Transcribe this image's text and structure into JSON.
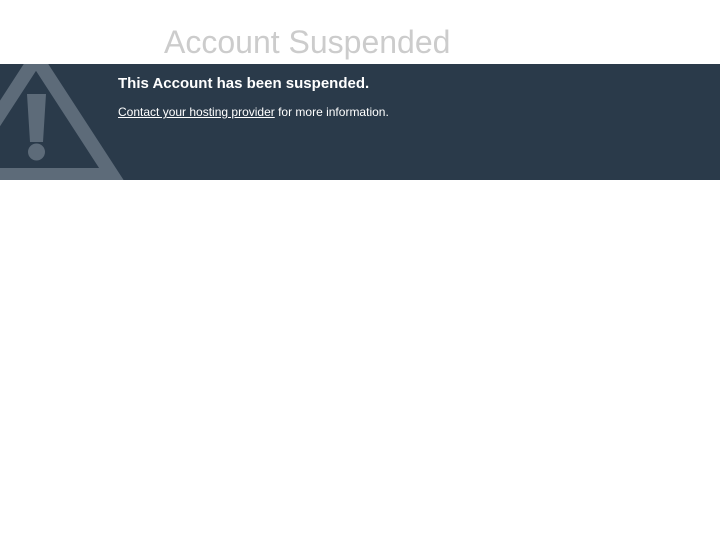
{
  "page": {
    "title": "Account Suspended"
  },
  "banner": {
    "heading": "This Account has been suspended.",
    "link_text": "Contact your hosting provider",
    "suffix_text": " for more information.",
    "icon": "warning-icon",
    "background_color": "#2a3a4a"
  }
}
